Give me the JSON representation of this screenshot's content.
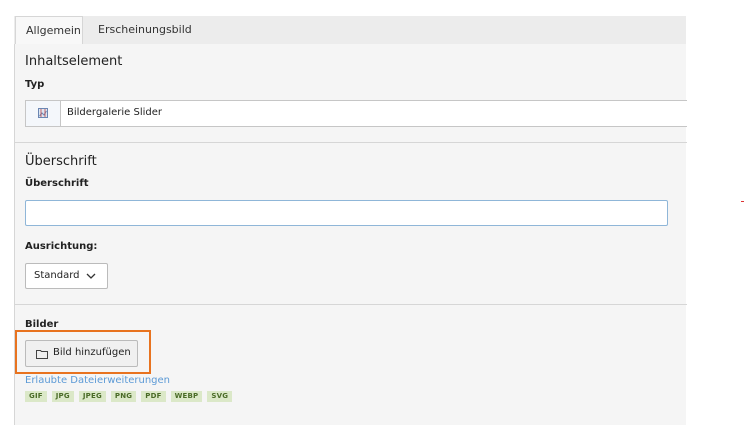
{
  "tabs": [
    {
      "label": "Allgemein",
      "active": true
    },
    {
      "label": "Erscheinungsbild",
      "active": false
    }
  ],
  "content_element": {
    "section_title": "Inhaltselement",
    "type_label": "Typ",
    "type_value": "Bildergalerie Slider",
    "type_icon": "image-gallery-icon"
  },
  "header": {
    "section_title": "Überschrift",
    "field_label": "Überschrift",
    "field_value": "",
    "alignment_label": "Ausrichtung:",
    "alignment_value": "Standard"
  },
  "images": {
    "label": "Bilder",
    "add_button_label": "Bild hinzufügen",
    "add_button_icon": "folder-icon",
    "allowed_extensions_link": "Erlaubte Dateierweiterungen",
    "extensions": [
      "GIF",
      "JPG",
      "JPEG",
      "PNG",
      "PDF",
      "WEBP",
      "SVG"
    ]
  },
  "colors": {
    "highlight": "#e8731f",
    "link": "#5c9ad6",
    "badge_bg": "#dbe8c8",
    "badge_text": "#4a6b27"
  }
}
